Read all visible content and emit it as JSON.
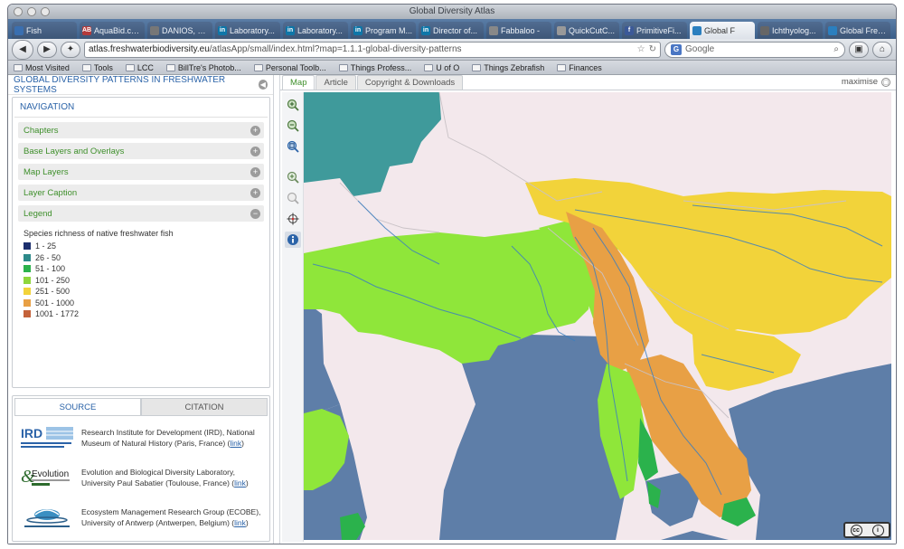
{
  "browser": {
    "window_title": "Global Diversity Atlas",
    "tabs": [
      {
        "label": "Fish",
        "icon": "fish-icon",
        "color": "#3a6fb0",
        "glyph": "",
        "active": false
      },
      {
        "label": "AquaBid.co...",
        "icon": "aquabid-icon",
        "color": "#b33a3a",
        "glyph": "AB",
        "active": false
      },
      {
        "label": "DANIOS, D...",
        "icon": "page-icon",
        "color": "#777777",
        "glyph": "",
        "active": false
      },
      {
        "label": "Laboratory...",
        "icon": "linkedin-icon",
        "color": "#0e76a8",
        "glyph": "in",
        "active": false
      },
      {
        "label": "Laboratory...",
        "icon": "linkedin-icon",
        "color": "#0e76a8",
        "glyph": "in",
        "active": false
      },
      {
        "label": "Program M...",
        "icon": "linkedin-icon",
        "color": "#0e76a8",
        "glyph": "in",
        "active": false
      },
      {
        "label": "Director of...",
        "icon": "linkedin-icon",
        "color": "#0e76a8",
        "glyph": "in",
        "active": false
      },
      {
        "label": "Fabbaloo -",
        "icon": "page-icon",
        "color": "#888888",
        "glyph": "",
        "active": false
      },
      {
        "label": "QuickCutC...",
        "icon": "page-icon",
        "color": "#999999",
        "glyph": "",
        "active": false
      },
      {
        "label": "PrimitiveFi...",
        "icon": "facebook-icon",
        "color": "#3b5998",
        "glyph": "f",
        "active": false
      },
      {
        "label": "Global F",
        "icon": "atlas-icon",
        "color": "#2b7fbf",
        "glyph": "",
        "active": true
      },
      {
        "label": "Ichthyolog...",
        "icon": "page-icon",
        "color": "#666666",
        "glyph": "",
        "active": false
      },
      {
        "label": "Global Fres...",
        "icon": "globe-icon",
        "color": "#2b7fbf",
        "glyph": "",
        "active": false
      }
    ],
    "url_site": "atlas.freshwaterbiodiversity.eu",
    "url_path": "/atlasApp/small/index.html?map=1.1.1-global-diversity-patterns",
    "search_placeholder": "Google",
    "bookmarks": [
      {
        "label": "Most Visited"
      },
      {
        "label": "Tools"
      },
      {
        "label": "LCC"
      },
      {
        "label": "BillTre's Photob..."
      },
      {
        "label": "Personal Toolb..."
      },
      {
        "label": "Things Profess..."
      },
      {
        "label": "U of O"
      },
      {
        "label": "Things Zebrafish"
      },
      {
        "label": "Finances"
      }
    ]
  },
  "sidebar": {
    "title": "GLOBAL DIVERSITY PATTERNS IN FRESHWATER SYSTEMS",
    "navigation_title": "NAVIGATION",
    "sections": [
      {
        "label": "Chapters"
      },
      {
        "label": "Base Layers and Overlays"
      },
      {
        "label": "Map Layers"
      },
      {
        "label": "Layer Caption"
      },
      {
        "label": "Legend"
      }
    ],
    "legend": {
      "title": "Species richness of native freshwater fish",
      "classes": [
        {
          "label": "1 - 25",
          "color": "#1c2f6e"
        },
        {
          "label": "26 - 50",
          "color": "#2d8a8a"
        },
        {
          "label": "51 - 100",
          "color": "#2bb24c"
        },
        {
          "label": "101 - 250",
          "color": "#8fd63c"
        },
        {
          "label": "251 - 500",
          "color": "#f2d33a"
        },
        {
          "label": "501 - 1000",
          "color": "#e8a045"
        },
        {
          "label": "1001 - 1772",
          "color": "#c4623a"
        }
      ]
    }
  },
  "source": {
    "tabs": {
      "source": "SOURCE",
      "citation": "CITATION"
    },
    "items": [
      {
        "text": "Research Institute for Development (IRD), National Museum of Natural History (Paris, France)",
        "link": "link",
        "logo": "IRD"
      },
      {
        "text": "Evolution and Biological Diversity Laboratory, University Paul Sabatier (Toulouse, France)",
        "link": "link",
        "logo": "Evolution"
      },
      {
        "text": "Ecosystem Management Research Group (ECOBE), University of Antwerp (Antwerpen, Belgium)",
        "link": "link",
        "logo": "ECOBE"
      }
    ]
  },
  "map": {
    "tabs": [
      {
        "label": "Map",
        "active": true
      },
      {
        "label": "Article",
        "active": false
      },
      {
        "label": "Copyright & Downloads",
        "active": false
      }
    ],
    "maximise_label": "maximise",
    "license": "cc-by",
    "colors": {
      "water": "#5e7ea8",
      "land": "#f3e8ec",
      "border": "#c8c8c8",
      "river": "#3c7ebf"
    }
  }
}
